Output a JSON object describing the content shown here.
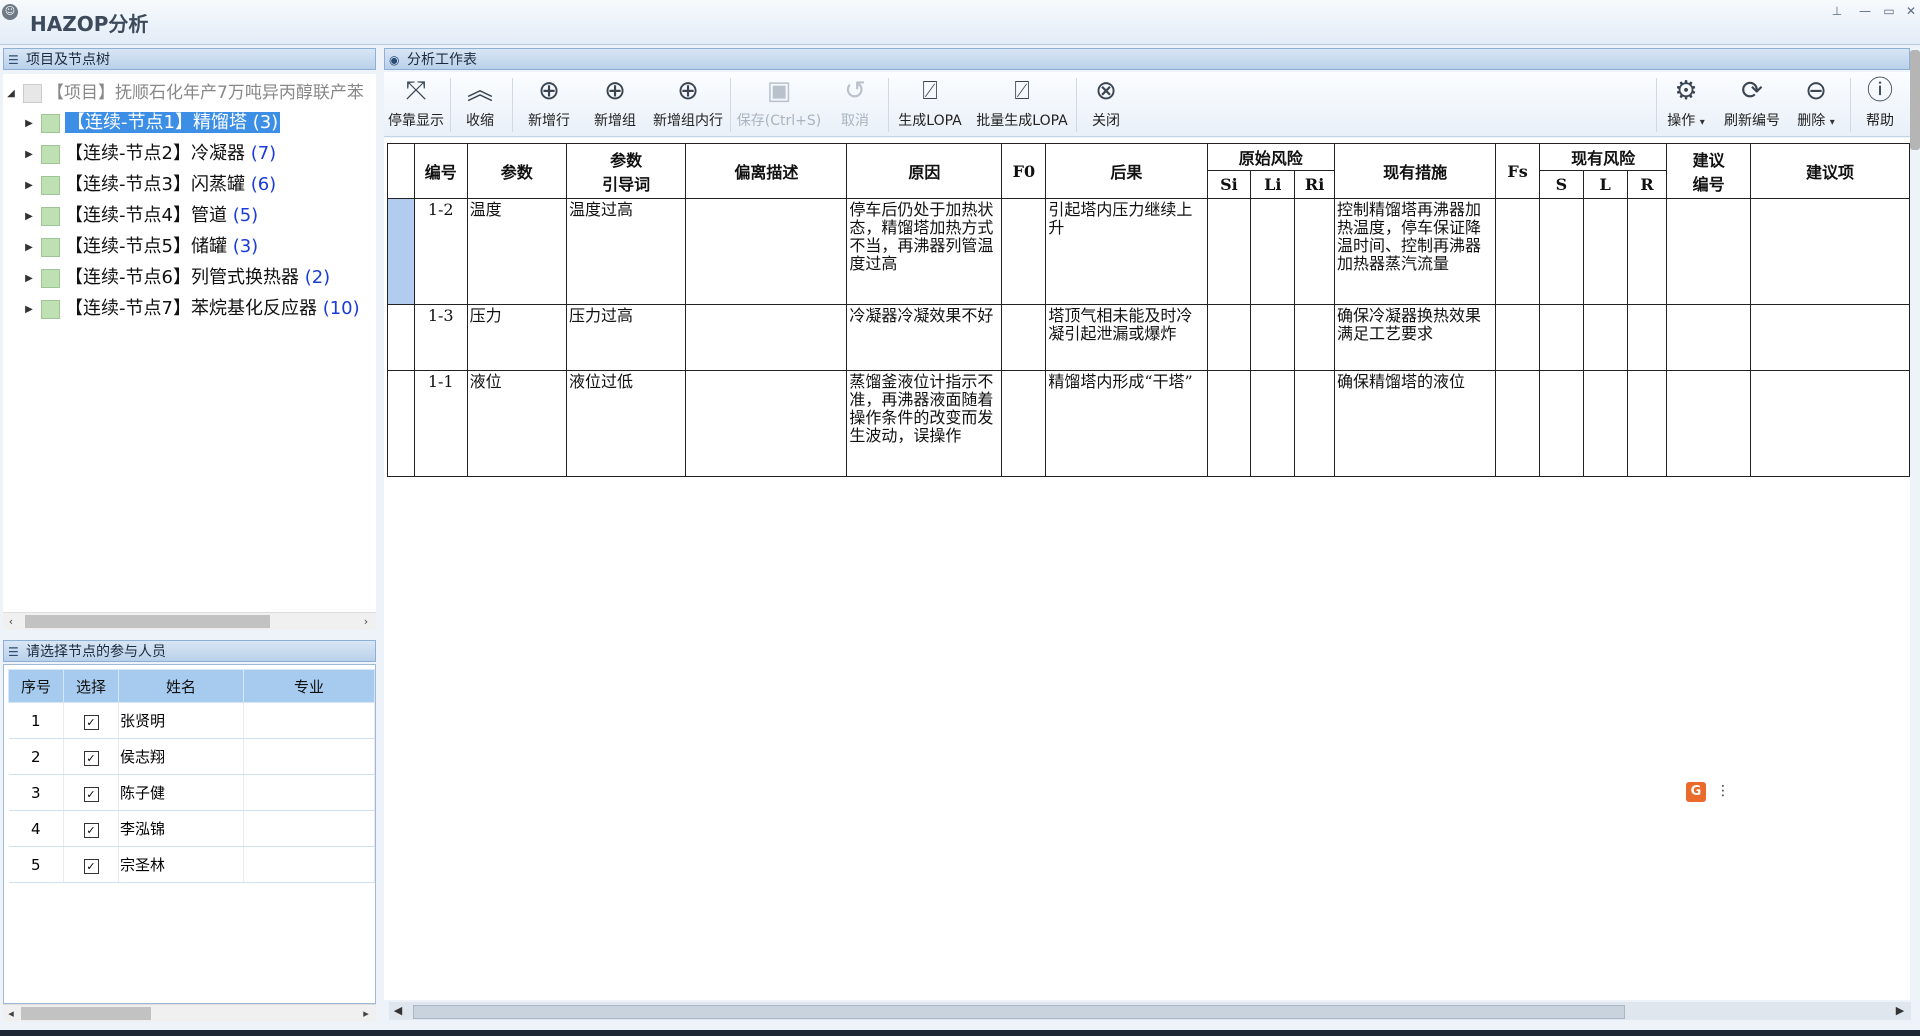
{
  "window": {
    "title": "HAZOP分析"
  },
  "left_panel": {
    "title": "项目及节点树",
    "root": "【项目】抚顺石化年产7万吨异丙醇联产苯",
    "nodes": [
      {
        "label": "【连续-节点1】精馏塔",
        "count": "(3)",
        "selected": true
      },
      {
        "label": "【连续-节点2】冷凝器",
        "count": "(7)"
      },
      {
        "label": "【连续-节点3】闪蒸罐",
        "count": "(6)"
      },
      {
        "label": "【连续-节点4】管道",
        "count": "(5)"
      },
      {
        "label": "【连续-节点5】储罐",
        "count": "(3)"
      },
      {
        "label": "【连续-节点6】列管式换热器",
        "count": "(2)"
      },
      {
        "label": "【连续-节点7】苯烷基化反应器",
        "count": "(10)"
      }
    ]
  },
  "participants_panel": {
    "title": "请选择节点的参与人员",
    "columns": [
      "序号",
      "选择",
      "姓名",
      "专业"
    ],
    "rows": [
      {
        "no": "1",
        "checked": "✓",
        "name": "张贤明",
        "major": ""
      },
      {
        "no": "2",
        "checked": "✓",
        "name": "侯志翔",
        "major": ""
      },
      {
        "no": "3",
        "checked": "✓",
        "name": "陈子健",
        "major": ""
      },
      {
        "no": "4",
        "checked": "✓",
        "name": "李泓锦",
        "major": ""
      },
      {
        "no": "5",
        "checked": "✓",
        "name": "宗圣林",
        "major": ""
      }
    ]
  },
  "worksheet_panel": {
    "title": "分析工作表",
    "toolbar": {
      "dock": "停靠显示",
      "collapse": "收缩",
      "add_row": "新增行",
      "add_group": "新增组",
      "add_group_row": "新增组内行",
      "save": "保存(Ctrl+S)",
      "cancel": "取消",
      "gen_lopa": "生成LOPA",
      "batch_lopa": "批量生成LOPA",
      "close": "关闭",
      "operate": "操作",
      "refresh_no": "刷新编号",
      "delete": "删除",
      "help": "帮助"
    },
    "headers": {
      "no": "编号",
      "param": "参数",
      "guideword_1": "参数",
      "guideword_2": "引导词",
      "deviation": "偏离描述",
      "cause": "原因",
      "f0": "F0",
      "consequence": "后果",
      "orig_risk": "原始风险",
      "si": "Si",
      "li": "Li",
      "ri": "Ri",
      "measures": "现有措施",
      "fs": "Fs",
      "cur_risk": "现有风险",
      "s": "S",
      "l": "L",
      "r": "R",
      "sugg_no_1": "建议",
      "sugg_no_2": "编号",
      "sugg": "建议项"
    },
    "rows": [
      {
        "no": "1-2",
        "param": "温度",
        "guideword": "温度过高",
        "deviation": "",
        "cause": "停车后仍处于加热状态，精馏塔加热方式不当，再沸器列管温度过高",
        "f0": "",
        "consequence": "引起塔内压力继续上升",
        "si": "",
        "li": "",
        "ri": "",
        "measures": "控制精馏塔再沸器加热温度，停车保证降温时间、控制再沸器加热器蒸汽流量",
        "fs": "",
        "s": "",
        "l": "",
        "r": "",
        "sugg_no": "",
        "sugg": ""
      },
      {
        "no": "1-3",
        "param": "压力",
        "guideword": "压力过高",
        "deviation": "",
        "cause": "冷凝器冷凝效果不好",
        "f0": "",
        "consequence": "塔顶气相未能及时冷凝引起泄漏或爆炸",
        "si": "",
        "li": "",
        "ri": "",
        "measures": "确保冷凝器换热效果满足工艺要求",
        "fs": "",
        "s": "",
        "l": "",
        "r": "",
        "sugg_no": "",
        "sugg": ""
      },
      {
        "no": "1-1",
        "param": "液位",
        "guideword": "液位过低",
        "deviation": "",
        "cause": "蒸馏釜液位计指示不准，再沸器液面随着操作条件的改变而发生波动，误操作",
        "f0": "",
        "consequence": "精馏塔内形成“干塔”",
        "si": "",
        "li": "",
        "ri": "",
        "measures": "确保精馏塔的液位",
        "fs": "",
        "s": "",
        "l": "",
        "r": "",
        "sugg_no": "",
        "sugg": ""
      }
    ]
  },
  "colors": {
    "selected_node": "#3d8fe6",
    "count_text": "#1b3cd6",
    "header_blue": "#a6cbef",
    "row_marker": "#b2ccef"
  },
  "icons": [
    "pin-icon",
    "minimize-icon",
    "maximize-icon",
    "close-icon",
    "list-icon",
    "grammarly-icon"
  ]
}
